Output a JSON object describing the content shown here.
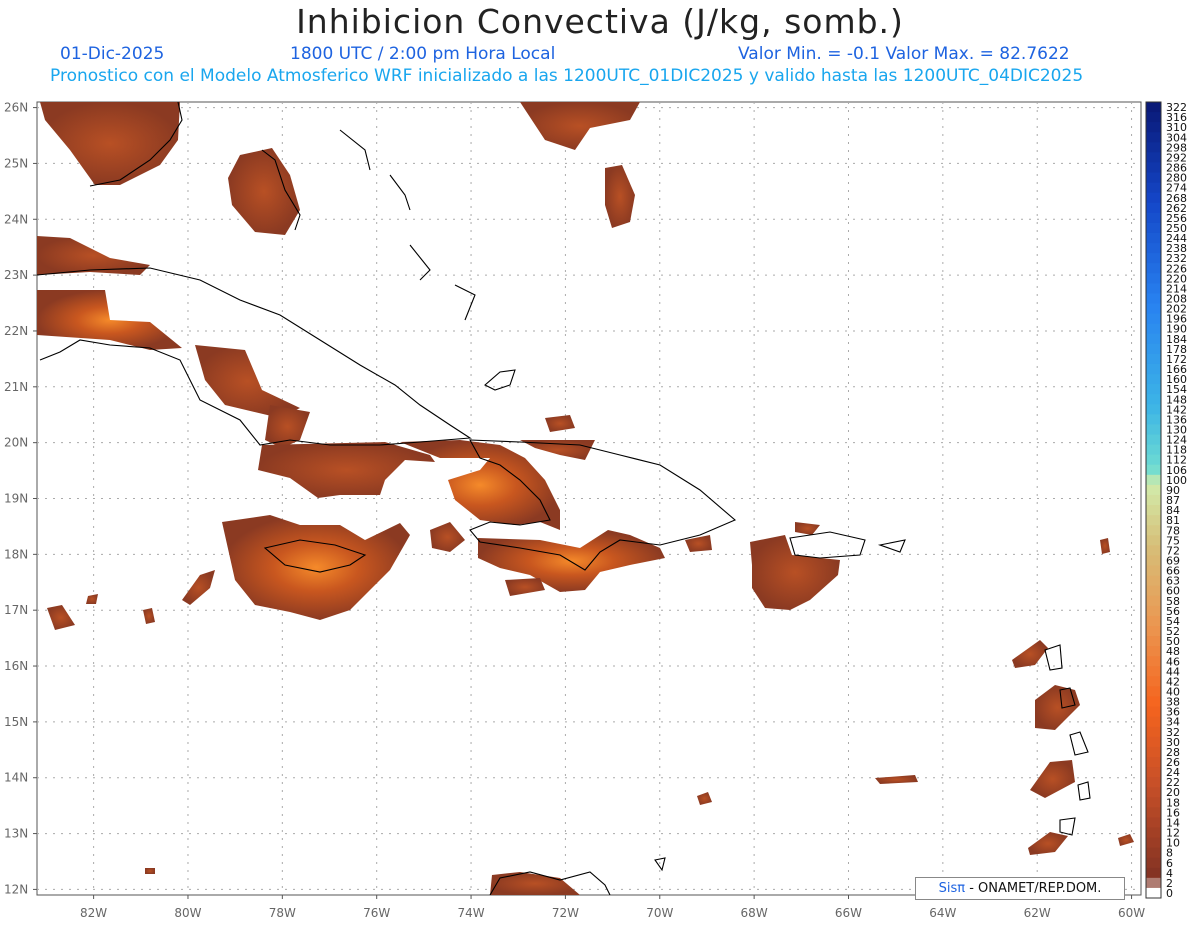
{
  "header": {
    "title": "Inhibicion Convectiva (J/kg, somb.)",
    "date": "01-Dic-2025",
    "time": "1800 UTC / 2:00 pm Hora Local",
    "range": "Valor Min. = -0.1   Valor Max. = 82.7622",
    "model": "Pronostico con el Modelo Atmosferico WRF inicializado a las 1200UTC_01DIC2025 y valido hasta las  1200UTC_04DIC2025"
  },
  "map": {
    "lat_labels": [
      "26N",
      "25N",
      "24N",
      "23N",
      "22N",
      "21N",
      "20N",
      "19N",
      "18N",
      "17N",
      "16N",
      "15N",
      "14N",
      "13N",
      "12N"
    ],
    "lon_labels": [
      "82W",
      "80W",
      "78W",
      "76W",
      "74W",
      "72W",
      "70W",
      "68W",
      "66W",
      "64W",
      "62W",
      "60W"
    ],
    "lat_values": [
      26,
      25,
      24,
      23,
      22,
      21,
      20,
      19,
      18,
      17,
      16,
      15,
      14,
      13,
      12
    ],
    "lon_values": [
      -82,
      -80,
      -78,
      -76,
      -74,
      -72,
      -70,
      -68,
      -66,
      -64,
      -62,
      -60
    ],
    "extent": {
      "lon_min": -83.2,
      "lon_max": -59.8,
      "lat_min": 11.9,
      "lat_max": 26.1
    },
    "field_color": "#8b3a22",
    "field_peak_color": "#f07020",
    "coast_color": "#000000",
    "grid_color": "#aaaaaa"
  },
  "colorbar": {
    "labels": [
      "322",
      "316",
      "310",
      "304",
      "298",
      "292",
      "286",
      "280",
      "274",
      "268",
      "262",
      "256",
      "250",
      "244",
      "238",
      "232",
      "226",
      "220",
      "214",
      "208",
      "202",
      "196",
      "190",
      "184",
      "178",
      "172",
      "166",
      "160",
      "154",
      "148",
      "142",
      "136",
      "130",
      "124",
      "118",
      "112",
      "106",
      "100",
      "90",
      "87",
      "84",
      "81",
      "78",
      "75",
      "72",
      "69",
      "66",
      "63",
      "60",
      "58",
      "56",
      "54",
      "52",
      "50",
      "48",
      "46",
      "44",
      "42",
      "40",
      "38",
      "36",
      "34",
      "32",
      "30",
      "28",
      "26",
      "24",
      "22",
      "20",
      "18",
      "16",
      "14",
      "12",
      "10",
      "8",
      "6",
      "4",
      "2",
      "0"
    ],
    "top_color": "#0a1a78",
    "bottom_color": "#ffffff"
  },
  "credit": {
    "brand": "Sisπ",
    "text": " - ONAMET/REP.DOM."
  }
}
